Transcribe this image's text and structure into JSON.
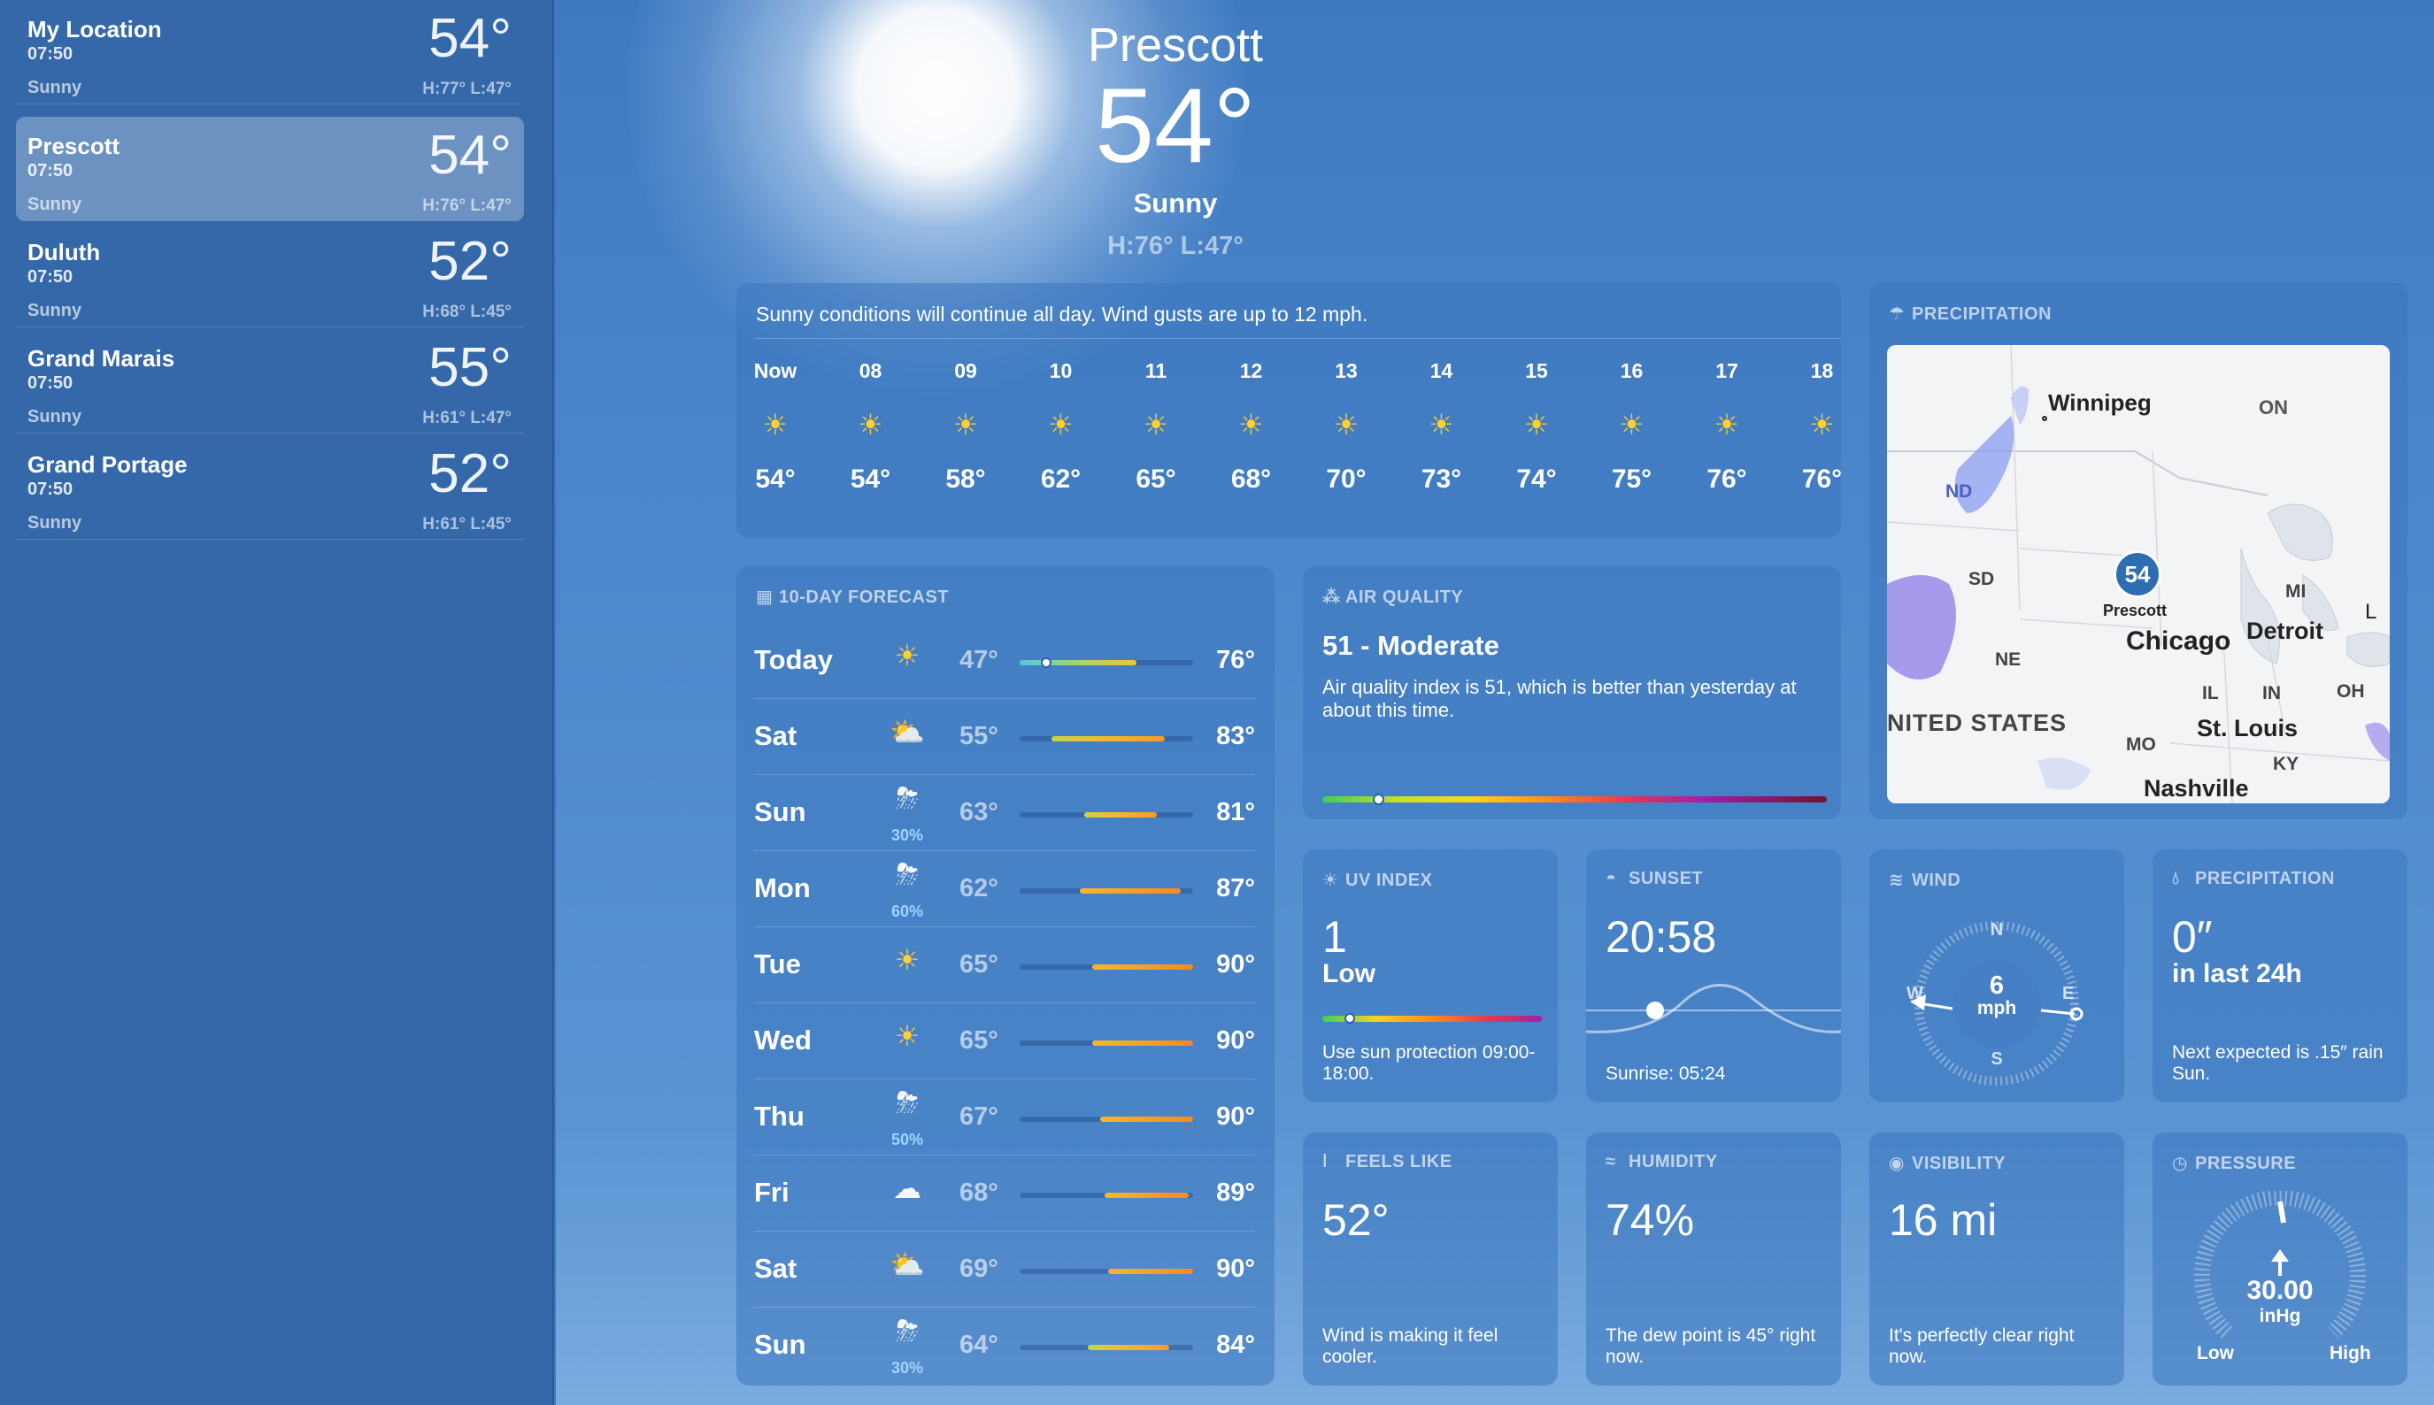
{
  "sidebar": {
    "locations": [
      {
        "name": "My Location",
        "time": "07:50",
        "temp": "54°",
        "condition": "Sunny",
        "hilo": "H:77°  L:47°"
      },
      {
        "name": "Prescott",
        "time": "07:50",
        "temp": "54°",
        "condition": "Sunny",
        "hilo": "H:76°  L:47°"
      },
      {
        "name": "Duluth",
        "time": "07:50",
        "temp": "52°",
        "condition": "Sunny",
        "hilo": "H:68°  L:45°"
      },
      {
        "name": "Grand Marais",
        "time": "07:50",
        "temp": "55°",
        "condition": "Sunny",
        "hilo": "H:61°  L:47°"
      },
      {
        "name": "Grand Portage",
        "time": "07:50",
        "temp": "52°",
        "condition": "Sunny",
        "hilo": "H:61°  L:45°"
      }
    ]
  },
  "hero": {
    "city": "Prescott",
    "temp": "54°",
    "condition": "Sunny",
    "hilo": "H:76°  L:47°"
  },
  "hourly": {
    "summary": "Sunny conditions will continue all day. Wind gusts are up to 12 mph.",
    "hours": [
      {
        "h": "Now",
        "t": "54°"
      },
      {
        "h": "08",
        "t": "54°"
      },
      {
        "h": "09",
        "t": "58°"
      },
      {
        "h": "10",
        "t": "62°"
      },
      {
        "h": "11",
        "t": "65°"
      },
      {
        "h": "12",
        "t": "68°"
      },
      {
        "h": "13",
        "t": "70°"
      },
      {
        "h": "14",
        "t": "73°"
      },
      {
        "h": "15",
        "t": "74°"
      },
      {
        "h": "16",
        "t": "75°"
      },
      {
        "h": "17",
        "t": "76°"
      },
      {
        "h": "18",
        "t": "76°"
      }
    ]
  },
  "tenday": {
    "title": "10-DAY FORECAST",
    "days": [
      {
        "day": "Today",
        "icon": "sun",
        "pct": "",
        "lo": "47°",
        "hi": "76°"
      },
      {
        "day": "Sat",
        "icon": "partly-cloudy",
        "pct": "",
        "lo": "55°",
        "hi": "83°"
      },
      {
        "day": "Sun",
        "icon": "thunderstorm",
        "pct": "30%",
        "lo": "63°",
        "hi": "81°"
      },
      {
        "day": "Mon",
        "icon": "thunderstorm",
        "pct": "60%",
        "lo": "62°",
        "hi": "87°"
      },
      {
        "day": "Tue",
        "icon": "sun",
        "pct": "",
        "lo": "65°",
        "hi": "90°"
      },
      {
        "day": "Wed",
        "icon": "sun",
        "pct": "",
        "lo": "65°",
        "hi": "90°"
      },
      {
        "day": "Thu",
        "icon": "thunderstorm",
        "pct": "50%",
        "lo": "67°",
        "hi": "90°"
      },
      {
        "day": "Fri",
        "icon": "cloud",
        "pct": "",
        "lo": "68°",
        "hi": "89°"
      },
      {
        "day": "Sat",
        "icon": "partly-cloudy",
        "pct": "",
        "lo": "69°",
        "hi": "90°"
      },
      {
        "day": "Sun",
        "icon": "thunderstorm",
        "pct": "30%",
        "lo": "64°",
        "hi": "84°"
      }
    ]
  },
  "air": {
    "title": "AIR QUALITY",
    "value": "51 - Moderate",
    "desc": "Air quality index is 51, which is better than yesterday at about this time.",
    "level": 0.11
  },
  "map": {
    "title": "PRECIPITATION",
    "pin_value": "54",
    "pin_label": "Prescott",
    "labels": {
      "winnipeg": "Winnipeg",
      "on": "ON",
      "nd": "ND",
      "sd": "SD",
      "mi": "MI",
      "chicago": "Chicago",
      "detroit": "Detroit",
      "ne": "NE",
      "il": "IL",
      "in": "IN",
      "oh": "OH",
      "us": "NITED STATES",
      "stlouis": "St. Louis",
      "mo": "MO",
      "ky": "KY",
      "nashville": "Nashville",
      "l": "L"
    }
  },
  "uv": {
    "title": "UV INDEX",
    "value": "1",
    "level": "Low",
    "note": "Use sun protection 09:00-18:00.",
    "position": 0.1
  },
  "sunset": {
    "title": "SUNSET",
    "value": "20:58",
    "sunrise": "Sunrise: 05:24"
  },
  "wind": {
    "title": "WIND",
    "speed": "6",
    "unit": "mph",
    "n": "N",
    "e": "E",
    "s": "S",
    "w": "W"
  },
  "precip": {
    "title": "PRECIPITATION",
    "value": "0″",
    "sub": "in last 24h",
    "note": "Next expected is .15″ rain Sun."
  },
  "feels": {
    "title": "FEELS LIKE",
    "value": "52°",
    "note": "Wind is making it feel cooler."
  },
  "humidity": {
    "title": "HUMIDITY",
    "value": "74%",
    "note": "The dew point is 45° right now."
  },
  "visibility": {
    "title": "VISIBILITY",
    "value": "16 mi",
    "note": "It's perfectly clear right now."
  },
  "pressure": {
    "title": "PRESSURE",
    "value": "30.00",
    "unit": "inHg",
    "low": "Low",
    "high": "High"
  },
  "colors": {
    "sun": "#ffd02b",
    "rain_pct": "#9fd4ff",
    "card": "#3c76be"
  }
}
